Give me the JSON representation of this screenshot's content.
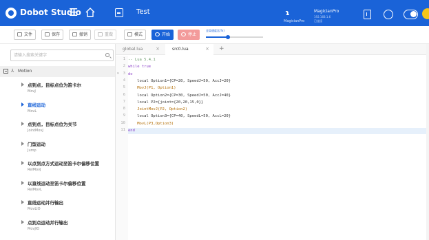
{
  "colors": {
    "accent": "#1a63d8",
    "header_bg": "#1a63d8",
    "stop": "#f39b9b",
    "avatar": "#f5c518",
    "active_line": "#e6f0fb"
  },
  "header": {
    "app_title": "Dobot Studio",
    "project_name": "Test",
    "robot": {
      "icon_label": "ɿ",
      "sub_label": "MagicianPro",
      "name": "MagicianPro",
      "ip": "192.168.1.6",
      "status": "已连接"
    }
  },
  "toolbar": {
    "file": "文件",
    "save": "保存",
    "undo": "撤销",
    "redo": "重做",
    "mode": "模式",
    "run": "开始",
    "stop": "停止",
    "speed_label": "全局速度比(%)",
    "speed_value": 0.38
  },
  "sidebar": {
    "search_placeholder": "请输入搜索关键字",
    "tree_root": "Motion",
    "items": [
      {
        "title": "点到点，目标点位为笛卡尔",
        "sub": "MovJ"
      },
      {
        "title": "直线运动",
        "sub": "MovL",
        "active": true
      },
      {
        "title": "点到点，目标点位为关节",
        "sub": "JointMovJ"
      },
      {
        "title": "门型运动",
        "sub": "Jump"
      },
      {
        "title": "以点到点方式运动至笛卡尔偏移位置",
        "sub": "RelMovJ"
      },
      {
        "title": "以直线运动至笛卡尔偏移位置",
        "sub": "RelMovL"
      },
      {
        "title": "直线运动并行输出",
        "sub": "MovLIO"
      },
      {
        "title": "点到点运动并行输出",
        "sub": "MovJIO"
      }
    ]
  },
  "editor": {
    "tabs": [
      {
        "label": "global.lua"
      },
      {
        "label": "src0.lua",
        "active": true
      }
    ],
    "lines": [
      {
        "num": "1",
        "text": "-- Lua 5.4.1",
        "cls": "cm"
      },
      {
        "num": "2",
        "text": "while true",
        "cls": "kw"
      },
      {
        "num": "3",
        "text": "do",
        "cls": "kw",
        "fold": true
      },
      {
        "num": "4",
        "text": "    local Option1={CP=20, SpeedJ=50, AccJ=20}",
        "cls": "tx"
      },
      {
        "num": "5",
        "text": "    MovJ(P1, Option1)",
        "cls": "fn"
      },
      {
        "num": "6",
        "text": "    local Option2={CP=30, SpeedJ=50, AccJ=40}",
        "cls": "tx"
      },
      {
        "num": "7",
        "text": "    local P2={joint={20,20,15,0}}",
        "cls": "tx"
      },
      {
        "num": "8",
        "text": "    JointMovJ(P2, Option2)",
        "cls": "fn"
      },
      {
        "num": "9",
        "text": "    local Option3={CP=40, SpeedL=50, AccL=20}",
        "cls": "tx"
      },
      {
        "num": "10",
        "text": "    MovL(P3,Option3)",
        "cls": "fn"
      },
      {
        "num": "11",
        "text": "end",
        "cls": "kw",
        "hl": true
      }
    ]
  }
}
